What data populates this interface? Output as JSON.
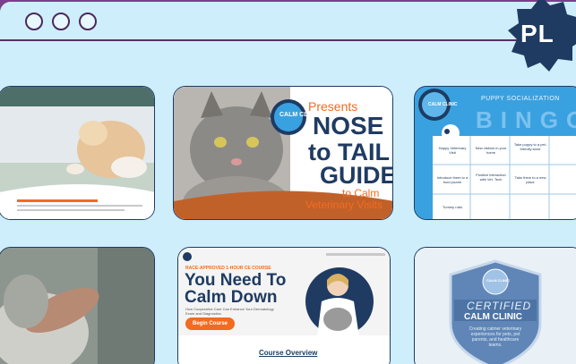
{
  "colors": {
    "frame_purple": "#7b3f8c",
    "window_bg": "#cfeefc",
    "brand_orange": "#f26b21",
    "brand_navy": "#1f3b62",
    "bingo_blue": "#3aa1e0"
  },
  "window": {
    "controls": [
      "window-dot-1",
      "window-dot-2",
      "window-dot-3"
    ]
  },
  "badge": {
    "text": "PL"
  },
  "cards": {
    "nose_to_tail": {
      "logo_text": "CALM CLINIC",
      "presents": "Presents",
      "title_line1": "NOSE",
      "title_line2": "to TAIL",
      "title_line3": "GUIDE",
      "subtitle_line1": "to Calm",
      "subtitle_line2": "Veterinary Visits"
    },
    "bingo": {
      "header": "PUPPY SOCIALIZATION",
      "title": "BINGO",
      "logo_text": "CALM CLINIC",
      "cells": [
        "Happy Veterinary Visit",
        "New visitors in your home",
        "Take puppy to a pet-friendly store",
        "",
        "Introduce them to a food puzzle",
        "Positive interaction with Vet. Tech",
        "Take them to a new place",
        "",
        "Tummy rubs",
        "",
        "",
        ""
      ]
    },
    "course": {
      "tag": "RACE-APPROVED 1-HOUR CE COURSE",
      "title_line1": "You Need To",
      "title_line2": "Calm Down",
      "description": "How Cooperative Care Can Enhance Your Dermatology Exam and Diagnostics",
      "cta": "Begin Course",
      "section_title": "Course Overview"
    },
    "certified": {
      "logo_text": "CALM CLINIC",
      "line1": "CERTIFIED",
      "line2": "CALM CLINIC",
      "tagline": "Creating calmer veterinary experiences for pets, pet parents, and healthcare teams."
    }
  }
}
